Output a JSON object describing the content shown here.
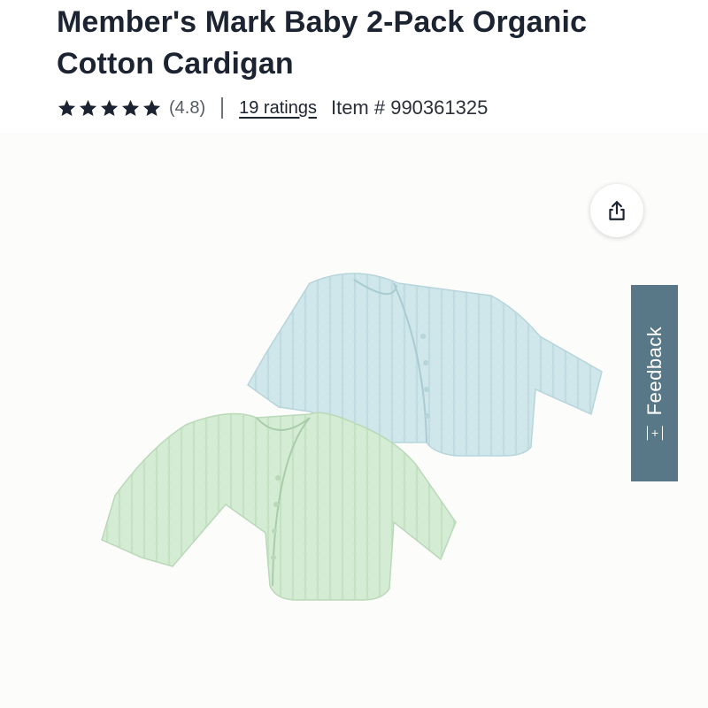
{
  "product": {
    "title": "Member's Mark Baby 2-Pack Organic Cotton Cardigan",
    "rating_value": "(4.8)",
    "ratings_count": "19 ratings",
    "item_number": "Item # 990361325",
    "stars": 5
  },
  "icons": {
    "star": "star-icon",
    "share": "share-icon",
    "feedback": "feedback-icon"
  },
  "feedback": {
    "label": "Feedback"
  },
  "colors": {
    "title": "#1c2331",
    "feedback_tab": "#587887",
    "cardigan_blue": "#cfe6ea",
    "cardigan_green": "#d4ecd3"
  }
}
